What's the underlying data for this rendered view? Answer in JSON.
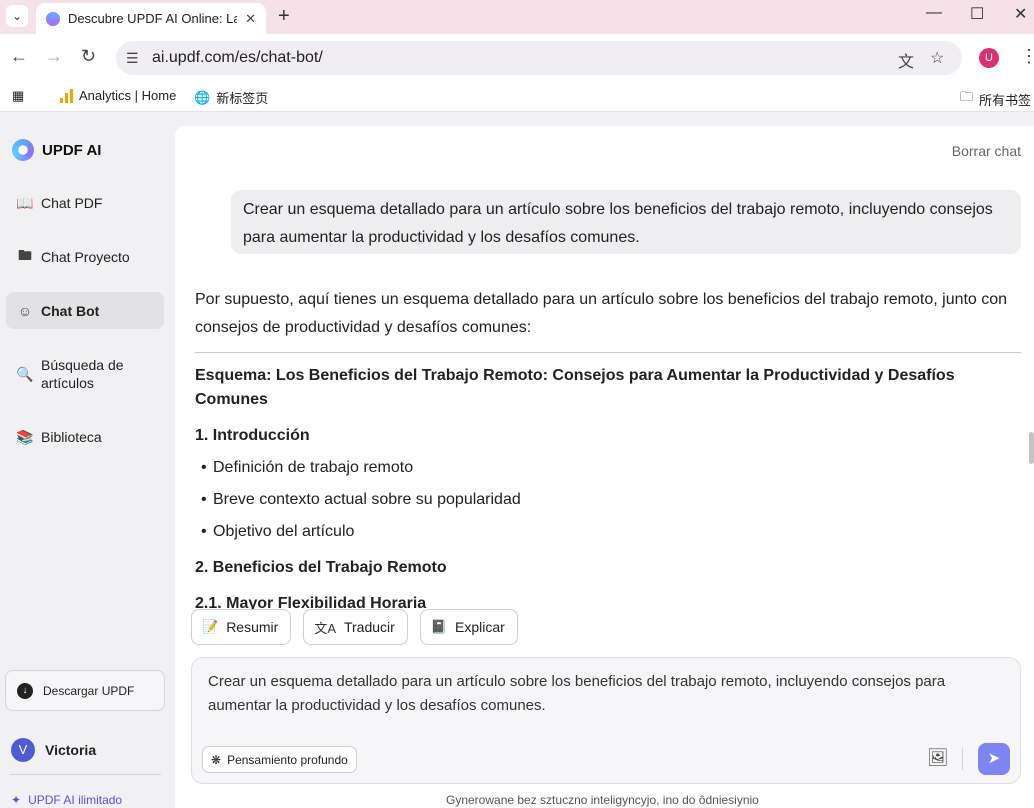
{
  "browser": {
    "tab_title": "Descubre UPDF AI Online: La",
    "url": "ai.updf.com/es/chat-bot/",
    "profile_initial": "U",
    "bookmarks": [
      "Analytics | Home",
      "新标签页"
    ],
    "bookmarks_folder": "所有书签"
  },
  "sidebar": {
    "brand": "UPDF AI",
    "items": [
      {
        "label": "Chat PDF",
        "icon": "book-open-icon"
      },
      {
        "label": "Chat Proyecto",
        "icon": "folder-icon"
      },
      {
        "label": "Chat Bot",
        "icon": "bot-icon",
        "active": true
      },
      {
        "label": "Búsqueda de artículos",
        "icon": "search-document-icon"
      },
      {
        "label": "Biblioteca",
        "icon": "library-icon"
      }
    ],
    "download_label": "Descargar UPDF",
    "user_initial": "V",
    "user_name": "Victoria",
    "unlimited_label": "UPDF AI ilimitado"
  },
  "chat": {
    "clear_label": "Borrar chat",
    "user_message": "Crear un esquema detallado para un artículo sobre los beneficios del trabajo remoto, incluyendo consejos para aumentar la productividad y los desafíos comunes.",
    "reply_intro": "Por supuesto, aquí tienes un esquema detallado para un artículo sobre los beneficios del trabajo remoto, junto con consejos de productividad y desafíos comunes:",
    "outline_title": "Esquema: Los Beneficios del Trabajo Remoto: Consejos para Aumentar la Productividad y Desafíos Comunes",
    "section1_title": "1. Introducción",
    "section1_items": [
      "Definición de trabajo remoto",
      "Breve contexto actual sobre su popularidad",
      "Objetivo del artículo"
    ],
    "section2_title": "2. Beneficios del Trabajo Remoto",
    "section21_title": "2.1. Mayor Flexibilidad Horaria"
  },
  "actions": {
    "summarize": "Resumir",
    "translate": "Traducir",
    "explain": "Explicar"
  },
  "composer": {
    "value": "Crear un esquema detallado para un artículo sobre los beneficios del trabajo remoto, incluyendo consejos para aumentar la productividad y los desafíos comunes.",
    "deep_thinking_label": "Pensamiento profundo"
  },
  "footer_note": "Gynerowane bez sztuczno inteligyncyjo, ino do ôdniesiynio",
  "colors": {
    "accent": "#7d86f0",
    "brand_purple": "#5b4fe0",
    "tab_bar": "#f5e1e8"
  }
}
